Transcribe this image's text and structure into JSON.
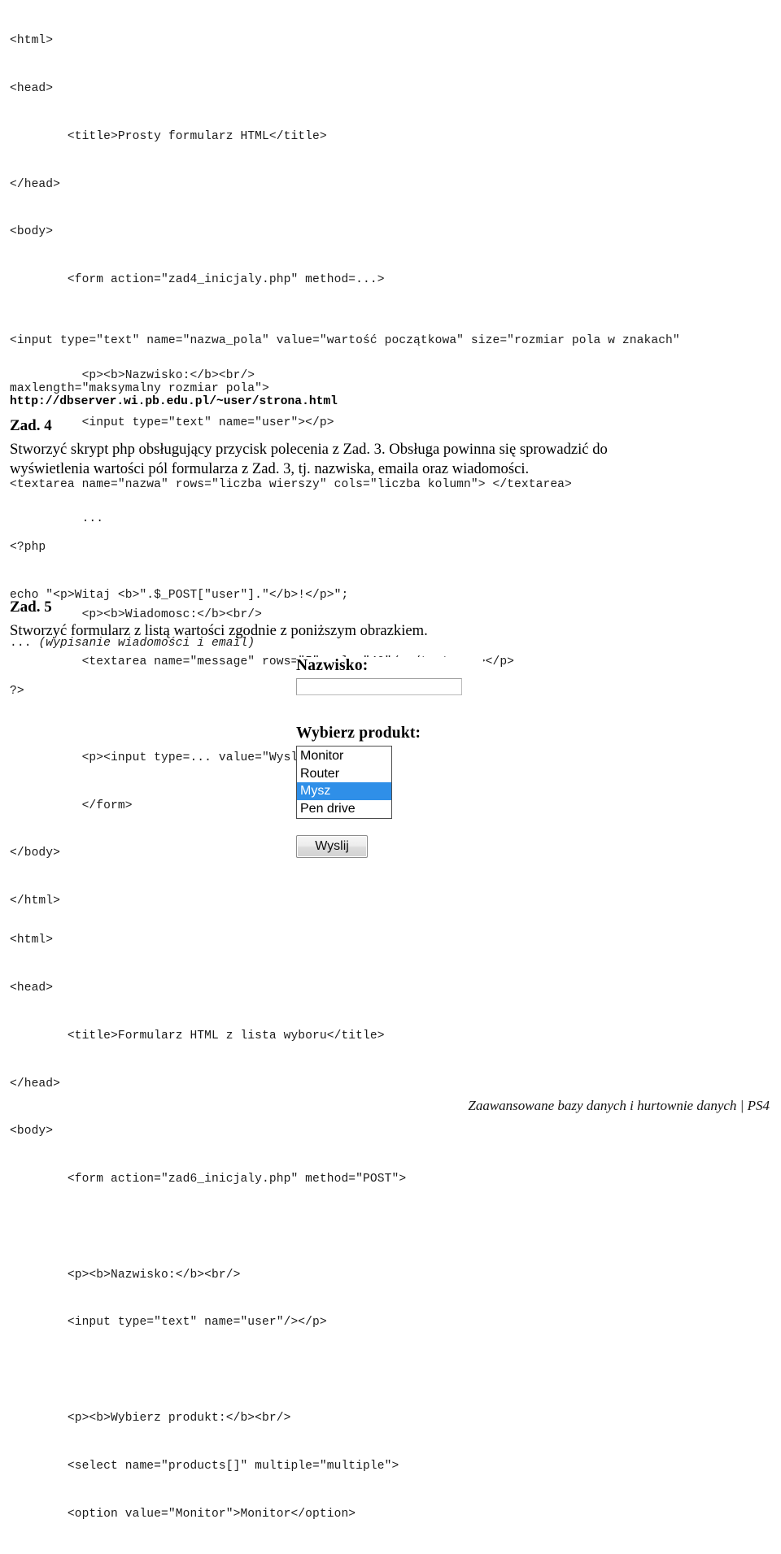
{
  "code_top": {
    "lines": [
      "<html>",
      "<head>",
      "        <title>Prosty formularz HTML</title>",
      "</head>",
      "<body>",
      "        <form action=\"zad4_inicjaly.php\" method=...>",
      "",
      "          <p><b>Nazwisko:</b><br/>",
      "          <input type=\"text\" name=\"user\"></p>",
      "",
      "          ...",
      "",
      "          <p><b>Wiadomosc:</b><br/>",
      "          <textarea name=\"message\" rows=\"5\" cols=\"40\"/></textarea></p>",
      "",
      "          <p><input type=... value=\"Wyslij\"/></p>",
      "          </form>",
      "</body>",
      "</html>"
    ]
  },
  "snippets": {
    "lines": [
      "<input type=\"text\" name=\"nazwa_pola\" value=\"wartość początkowa\" size=\"rozmiar pola w znakach\"",
      "maxlength=\"maksymalny rozmiar pola\">",
      "",
      "<textarea name=\"nazwa\" rows=\"liczba wierszy\" cols=\"liczba kolumn\"> </textarea>"
    ]
  },
  "url": "http://dbserver.wi.pb.edu.pl/~user/strona.html",
  "zad4": {
    "heading": "Zad. 4",
    "body": "Stworzyć skrypt php obsługujący przycisk polecenia z Zad. 3. Obsługa powinna się sprowadzić do\nwyświetlenia wartości pól formularza z Zad. 3, tj. nazwiska, emaila oraz wiadomości."
  },
  "php_code": {
    "line1": "<?php",
    "line2": "echo \"<p>Witaj <b>\".$_POST[\"user\"].\"</b>!</p>\";",
    "line3_prefix": "... ",
    "line3_italic": "(wypisanie wiadomości i email)",
    "line4": "?>"
  },
  "zad5": {
    "heading": "Zad. 5",
    "body": "Stworzyć formularz z listą wartości zgodnie z poniższym obrazkiem."
  },
  "form_screenshot": {
    "nazwisko_label": "Nazwisko:",
    "nazwisko_value": "",
    "produkt_label": "Wybierz produkt:",
    "options": [
      {
        "label": "Monitor",
        "selected": false
      },
      {
        "label": "Router",
        "selected": false
      },
      {
        "label": "Mysz",
        "selected": true
      },
      {
        "label": "Pen drive",
        "selected": false
      }
    ],
    "submit_label": "Wyslij",
    "selection_color": "#2f8fe8"
  },
  "code_bottom": {
    "lines": [
      "<html>",
      "<head>",
      "        <title>Formularz HTML z lista wyboru</title>",
      "</head>",
      "<body>",
      "        <form action=\"zad6_inicjaly.php\" method=\"POST\">",
      "",
      "        <p><b>Nazwisko:</b><br/>",
      "        <input type=\"text\" name=\"user\"/></p>",
      "",
      "        <p><b>Wybierz produkt:</b><br/>",
      "        <select name=\"products[]\" multiple=\"multiple\">",
      "        <option value=\"Monitor\">Monitor</option>"
    ]
  },
  "footer": "Zaawansowane bazy danych i hurtownie danych | PS4"
}
